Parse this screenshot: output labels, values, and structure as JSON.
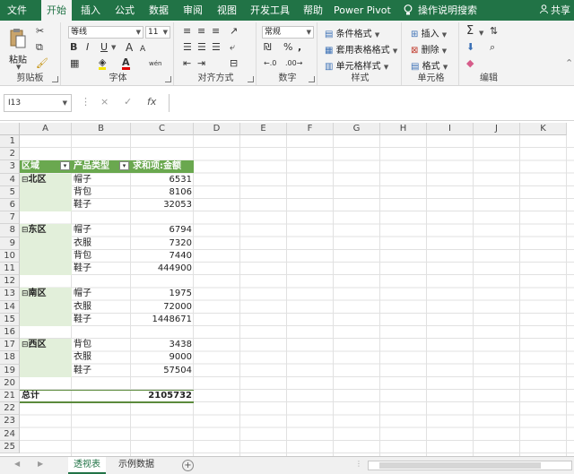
{
  "ribbon_tabs": [
    "文件",
    "开始",
    "插入",
    "公式",
    "数据",
    "审阅",
    "视图",
    "开发工具",
    "帮助",
    "Power Pivot",
    "操作说明搜索"
  ],
  "active_tab": "开始",
  "share_label": "共享",
  "clipboard": {
    "paste_label": "粘贴",
    "group_label": "剪贴板"
  },
  "font": {
    "family": "等线",
    "size": "11",
    "bold": "B",
    "italic": "I",
    "underline": "U",
    "grow": "A",
    "shrink": "A",
    "phonetic": "wén",
    "group_label": "字体"
  },
  "alignment": {
    "group_label": "对齐方式"
  },
  "number": {
    "format": "常规",
    "group_label": "数字"
  },
  "styles": {
    "conditional": "条件格式",
    "table": "套用表格格式",
    "cell": "单元格样式",
    "group_label": "样式"
  },
  "cells": {
    "insert": "插入",
    "delete": "删除",
    "format": "格式",
    "group_label": "单元格"
  },
  "editing": {
    "group_label": "编辑"
  },
  "name_box": "I13",
  "formula_bar": {
    "fx": "fx",
    "cancel": "×",
    "enter": "✓",
    "value": ""
  },
  "columns": [
    "A",
    "B",
    "C",
    "D",
    "E",
    "F",
    "G",
    "H",
    "I",
    "J",
    "K"
  ],
  "rows": [
    "1",
    "2",
    "3",
    "4",
    "5",
    "6",
    "7",
    "8",
    "9",
    "10",
    "11",
    "12",
    "13",
    "14",
    "15",
    "16",
    "17",
    "18",
    "19",
    "20",
    "21",
    "22",
    "23",
    "24",
    "25"
  ],
  "pivot": {
    "headers": [
      "区域",
      "产品类型",
      "求和项:金额"
    ],
    "collapse_symbol": "⊟",
    "regions": [
      {
        "name": "北区",
        "items": [
          [
            "帽子",
            "6531"
          ],
          [
            "背包",
            "8106"
          ],
          [
            "鞋子",
            "32053"
          ]
        ]
      },
      {
        "name": "东区",
        "items": [
          [
            "帽子",
            "6794"
          ],
          [
            "衣服",
            "7320"
          ],
          [
            "背包",
            "7440"
          ],
          [
            "鞋子",
            "444900"
          ]
        ]
      },
      {
        "name": "南区",
        "items": [
          [
            "帽子",
            "1975"
          ],
          [
            "衣服",
            "72000"
          ],
          [
            "鞋子",
            "1448671"
          ]
        ]
      },
      {
        "name": "西区",
        "items": [
          [
            "背包",
            "3438"
          ],
          [
            "衣服",
            "9000"
          ],
          [
            "鞋子",
            "57504"
          ]
        ]
      }
    ],
    "total_label": "总计",
    "total_value": "2105732"
  },
  "sheets": [
    "透视表",
    "示例数据"
  ],
  "active_sheet": "透视表",
  "colors": {
    "excel_green": "#217346",
    "header_green": "#6aa84f",
    "group_fill": "#e2efda"
  }
}
